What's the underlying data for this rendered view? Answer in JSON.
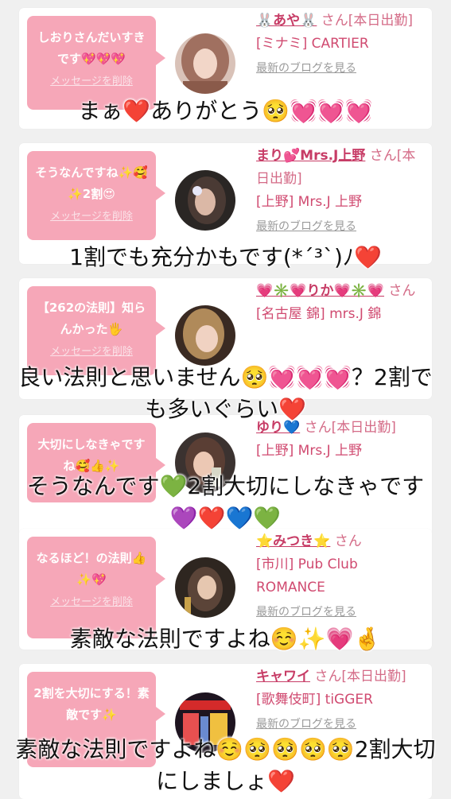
{
  "cards": [
    {
      "message": "しおりさんだいすきです💖💖💖",
      "delete_label": "メッセージを削除",
      "name": "🐰あや🐰",
      "name_suffix": "さん[本日出勤]",
      "shop": "[ミナミ] CARTIER",
      "blog_label": "最新のブログを見る",
      "caption": "まぁ❤️ありがとう🥺💓💓💓"
    },
    {
      "message": "そうなんですね✨🥰✨2割😍",
      "delete_label": "メッセージを削除",
      "name": "まり💕Mrs.J上野",
      "name_suffix": "さん[本日出勤]",
      "shop": "[上野] Mrs.J 上野",
      "blog_label": "最新のブログを見る",
      "caption": "1割でも充分かもです(*´³`)ﾉ❤️"
    },
    {
      "message": "【262の法則】知らんかった🖐",
      "delete_label": "メッセージを削除",
      "name": "💗✳️💗りか💗✳️💗",
      "name_suffix": "さん",
      "shop": "[名古屋 錦] mrs.J 錦",
      "blog_label": "",
      "caption": "良い法則と思いません🥺💓💓💓？2割でも多いぐらい❤️"
    },
    {
      "message": "大切にしなきゃですね🥰👍✨",
      "delete_label": "",
      "name": "ゆり💙",
      "name_suffix": "さん[本日出勤]",
      "shop": "[上野] Mrs.J 上野",
      "blog_label": "",
      "caption": "そうなんです💚2割大切にしなきゃです💜❤️💙💚"
    },
    {
      "message": "なるほど！の法則👍✨💖",
      "delete_label": "メッセージを削除",
      "name": "⭐みつき⭐",
      "name_suffix": "さん",
      "shop": "[市川] Pub Club ROMANCE",
      "blog_label": "最新のブログを見る",
      "caption": "素敵な法則ですよね☺️✨💗🤞"
    },
    {
      "message": "2割を大切にする！素敵です✨",
      "delete_label": "",
      "name": "キャワイ",
      "name_suffix": "さん[本日出勤]",
      "shop": "[歌舞伎町] tiGGER",
      "blog_label": "最新のブログを見る",
      "caption": "素敵な法則ですよね☺️🥺🥺🥺🥺2割大切にしましょ❤️"
    }
  ],
  "colors": {
    "bubble": "#f6a7b8",
    "name": "#c73c66",
    "card": "#ffffff",
    "background": "#f0f0f0"
  }
}
